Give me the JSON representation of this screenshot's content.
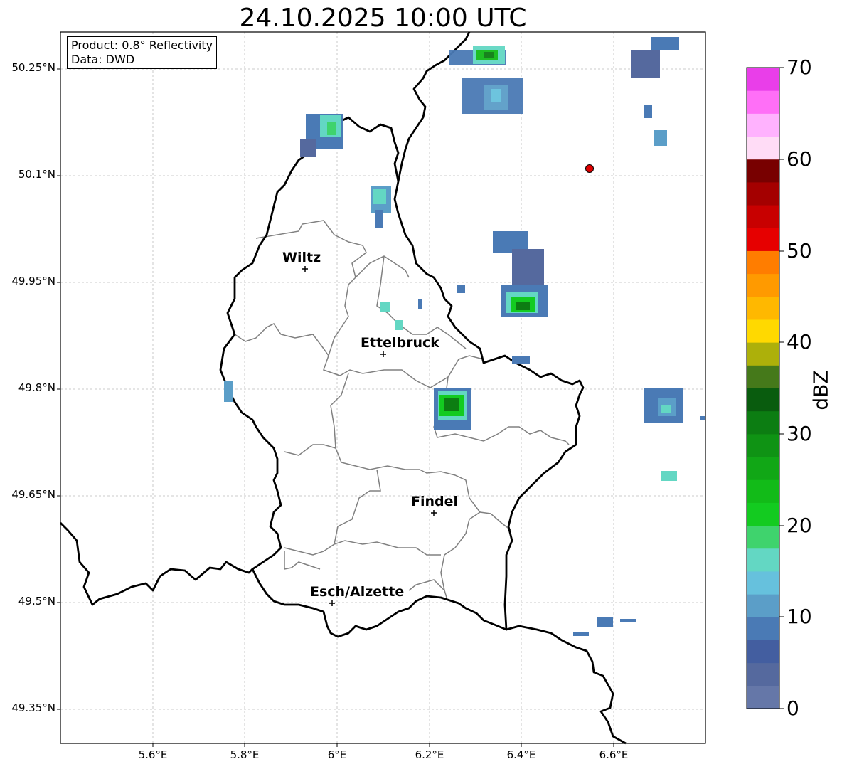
{
  "title": "24.10.2025 10:00 UTC",
  "info": {
    "product": "Product: 0.8° Reflectivity",
    "source": "Data: DWD"
  },
  "axes": {
    "lat_ticks": [
      "50.25°N",
      "50.1°N",
      "49.95°N",
      "49.8°N",
      "49.65°N",
      "49.5°N",
      "49.35°N"
    ],
    "lon_ticks": [
      "5.6°E",
      "5.8°E",
      "6°E",
      "6.2°E",
      "6.4°E",
      "6.6°E"
    ]
  },
  "cities": [
    {
      "name": "Wiltz",
      "lon": 5.93,
      "lat": 49.97
    },
    {
      "name": "Ettelbruck",
      "lon": 6.1,
      "lat": 49.85
    },
    {
      "name": "Findel",
      "lon": 6.21,
      "lat": 49.63
    },
    {
      "name": "Esch/Alzette",
      "lon": 5.99,
      "lat": 49.5
    }
  ],
  "radar_site_marker": {
    "lon": 6.55,
    "lat": 50.11,
    "color": "#e00000"
  },
  "colorbar": {
    "label": "dBZ",
    "ticks": [
      "0",
      "10",
      "20",
      "30",
      "40",
      "50",
      "60",
      "70"
    ],
    "colors": [
      "#6577a8",
      "#55699e",
      "#435ea0",
      "#4a7ab5",
      "#5b9ec8",
      "#66c1dd",
      "#63d7c3",
      "#3fd36d",
      "#13cb20",
      "#12bb18",
      "#11a716",
      "#0f9314",
      "#0c7d12",
      "#095c0e",
      "#45791a",
      "#adb00a",
      "#ffd900",
      "#ffb800",
      "#ff9a00",
      "#ff7d00",
      "#e60000",
      "#c80000",
      "#a40000",
      "#780000",
      "#ffdcf6",
      "#ffb2fe",
      "#ff6ff7",
      "#e93ee9"
    ]
  },
  "colors": {
    "border": "#000000",
    "canton": "#808080",
    "grid": "#bbbbbb"
  }
}
